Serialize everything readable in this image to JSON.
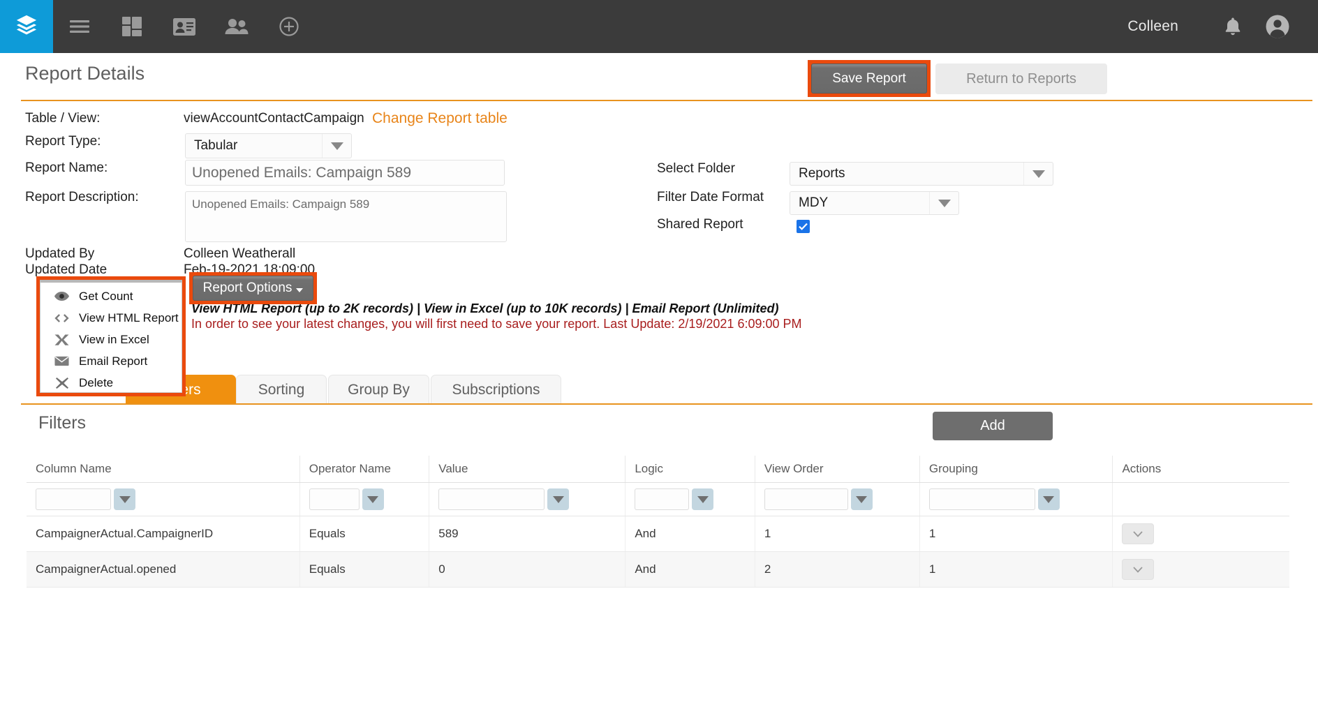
{
  "topnav": {
    "logo": "layers-icon",
    "icons": [
      "hamburger-menu-icon",
      "dashboard-grid-icon",
      "contact-card-icon",
      "people-icon",
      "add-circle-icon"
    ],
    "user_name": "Colleen",
    "bell": "notification-bell-icon",
    "account": "account-circle-icon",
    "bg_color": "#3b3b3b",
    "logo_color": "#0e9bd8"
  },
  "header": {
    "title": "Report Details",
    "save_label": "Save Report",
    "return_label": "Return to Reports",
    "accent_color": "#e8931f",
    "highlight_color": "#ea4a0d"
  },
  "form": {
    "table_view_label": "Table / View:",
    "table_view_value": "viewAccountContactCampaign",
    "change_table_link": "Change Report table",
    "report_type_label": "Report Type:",
    "report_type_value": "Tabular",
    "report_name_label": "Report Name:",
    "report_name_value": "Unopened Emails: Campaign 589",
    "report_desc_label": "Report Description:",
    "report_desc_value": "Unopened Emails: Campaign 589",
    "updated_by_label": "Updated By",
    "updated_by_value": "Colleen Weatherall",
    "updated_date_label": "Updated Date",
    "updated_date_value": "Feb-19-2021 18:09:00",
    "select_folder_label": "Select Folder",
    "select_folder_value": "Reports",
    "filter_date_format_label": "Filter Date Format",
    "filter_date_format_value": "MDY",
    "shared_report_label": "Shared Report",
    "shared_report_checked": true,
    "checkbox_color": "#1a73e8"
  },
  "report_options": {
    "button_label": "Report Options",
    "menu_items": [
      {
        "label": "Get Count",
        "icon": "eye-icon"
      },
      {
        "label": "View HTML Report",
        "icon": "code-brackets-icon"
      },
      {
        "label": "View in Excel",
        "icon": "excel-x-icon"
      },
      {
        "label": "Email Report",
        "icon": "envelope-icon"
      },
      {
        "label": "Delete",
        "icon": "close-x-icon"
      }
    ]
  },
  "info": {
    "limits_text": "View HTML Report (up to 2K records) | View in Excel (up to 10K records) | Email Report (Unlimited)",
    "warning_text": "In order to see your latest changes, you will first need to save your report. Last Update: 2/19/2021 6:09:00 PM",
    "warning_color": "#a81d1d"
  },
  "tabs": [
    {
      "label": "Filters",
      "active": true
    },
    {
      "label": "Sorting",
      "active": false
    },
    {
      "label": "Group By",
      "active": false
    },
    {
      "label": "Subscriptions",
      "active": false
    }
  ],
  "filters_panel": {
    "title": "Filters",
    "add_label": "Add",
    "columns": [
      "Column Name",
      "Operator Name",
      "Value",
      "Logic",
      "View Order",
      "Grouping",
      "Actions"
    ],
    "new_row_values": [
      "",
      "",
      "",
      "",
      "",
      ""
    ],
    "rows": [
      {
        "column_name": "CampaignerActual.CampaignerID",
        "operator_name": "Equals",
        "value": "589",
        "logic": "And",
        "view_order": "1",
        "grouping": "1",
        "action": "chevron-down-icon"
      },
      {
        "column_name": "CampaignerActual.opened",
        "operator_name": "Equals",
        "value": "0",
        "logic": "And",
        "view_order": "2",
        "grouping": "1",
        "action": "chevron-down-icon"
      }
    ]
  }
}
